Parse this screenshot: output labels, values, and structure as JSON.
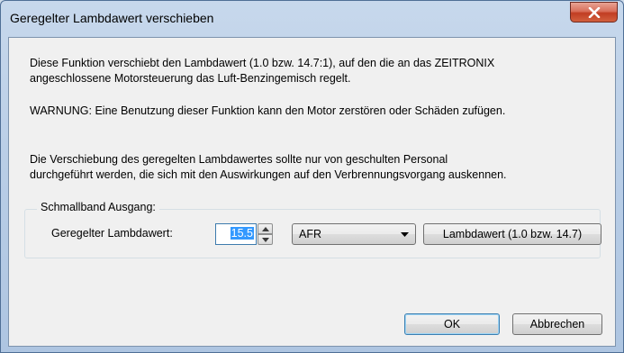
{
  "window": {
    "title": "Geregelter Lambdawert verschieben",
    "close_icon": "close-icon"
  },
  "content": {
    "description_line1": "Diese Funktion verschiebt den Lambdawert (1.0 bzw. 14.7:1), auf den die an das ZEITRONIX",
    "description_line2": "angeschlossene Motorsteuerung das Luft-Benzingemisch regelt.",
    "warning": "WARNUNG: Eine Benutzung dieser Funktion kann den Motor zerstören oder Schäden zufügen.",
    "note_line1": "Die Verschiebung des geregelten Lambdawertes sollte nur von geschulten Personal",
    "note_line2": "durchgeführt werden, die sich mit den Auswirkungen auf den Verbrennungsvorgang auskennen."
  },
  "group": {
    "label": "Schmallband Ausgang:",
    "field_label": "Geregelter Lambdawert:",
    "value": "15.5",
    "unit_selected": "AFR",
    "reset_button": "Lambdawert (1.0 bzw. 14.7)"
  },
  "buttons": {
    "ok": "OK",
    "cancel": "Abbrechen"
  },
  "colors": {
    "selection": "#3399ff",
    "close_button": "#c13d22"
  }
}
